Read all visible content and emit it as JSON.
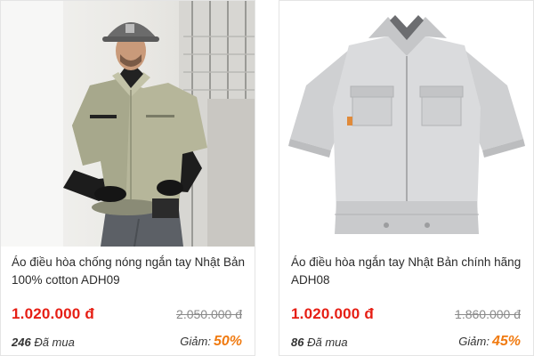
{
  "products": [
    {
      "title": "Áo điều hòa chống nóng ngắn tay Nhật Bản 100% cotton ADH09",
      "price": "1.020.000 đ",
      "old_price": "2.050.000 đ",
      "sold_count": "246",
      "sold_label": "Đã mua",
      "discount_label": "Giảm:",
      "discount_value": "50%",
      "image": "man-wearing-khaki-cooling-jacket-photo"
    },
    {
      "title": "Áo điều hòa ngắn tay Nhật Bản chính hãng ADH08",
      "price": "1.020.000 đ",
      "old_price": "1.860.000 đ",
      "sold_count": "86",
      "sold_label": "Đã mua",
      "discount_label": "Giảm:",
      "discount_value": "45%",
      "image": "grey-short-sleeve-cooling-jacket-photo"
    }
  ],
  "colors": {
    "price": "#e61e14",
    "discount": "#f07a10",
    "old_price": "#8a8a8a"
  }
}
